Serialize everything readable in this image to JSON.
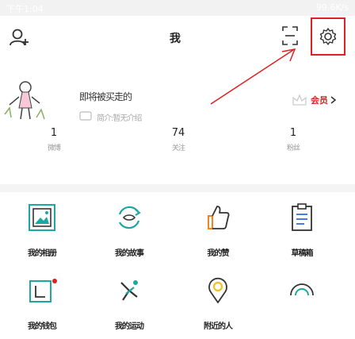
{
  "status": {
    "time": "下午1:04",
    "network": "99.6K/s"
  },
  "header": {
    "title": "我"
  },
  "profile": {
    "name": "即将被买走的",
    "bio": "简介:暂无介绍",
    "badge": "会员"
  },
  "stats": [
    {
      "value": "1",
      "label": "微博"
    },
    {
      "value": "74",
      "label": "关注"
    },
    {
      "value": "1",
      "label": "粉丝"
    }
  ],
  "grid": [
    {
      "label": "我的相册",
      "icon": "photo-album-icon"
    },
    {
      "label": "我的故事",
      "icon": "story-icon"
    },
    {
      "label": "我的赞",
      "icon": "thumbs-up-icon"
    },
    {
      "label": "草稿箱",
      "icon": "drafts-icon"
    },
    {
      "label": "我的钱包",
      "icon": "wallet-icon"
    },
    {
      "label": "我的运动",
      "icon": "exercise-icon"
    },
    {
      "label": "附近的人",
      "icon": "location-icon"
    },
    {
      "label": "",
      "icon": "arch-icon"
    }
  ],
  "colors": {
    "accent": "#f5821f",
    "highlight": "#e02020",
    "badge": "#e02020"
  }
}
